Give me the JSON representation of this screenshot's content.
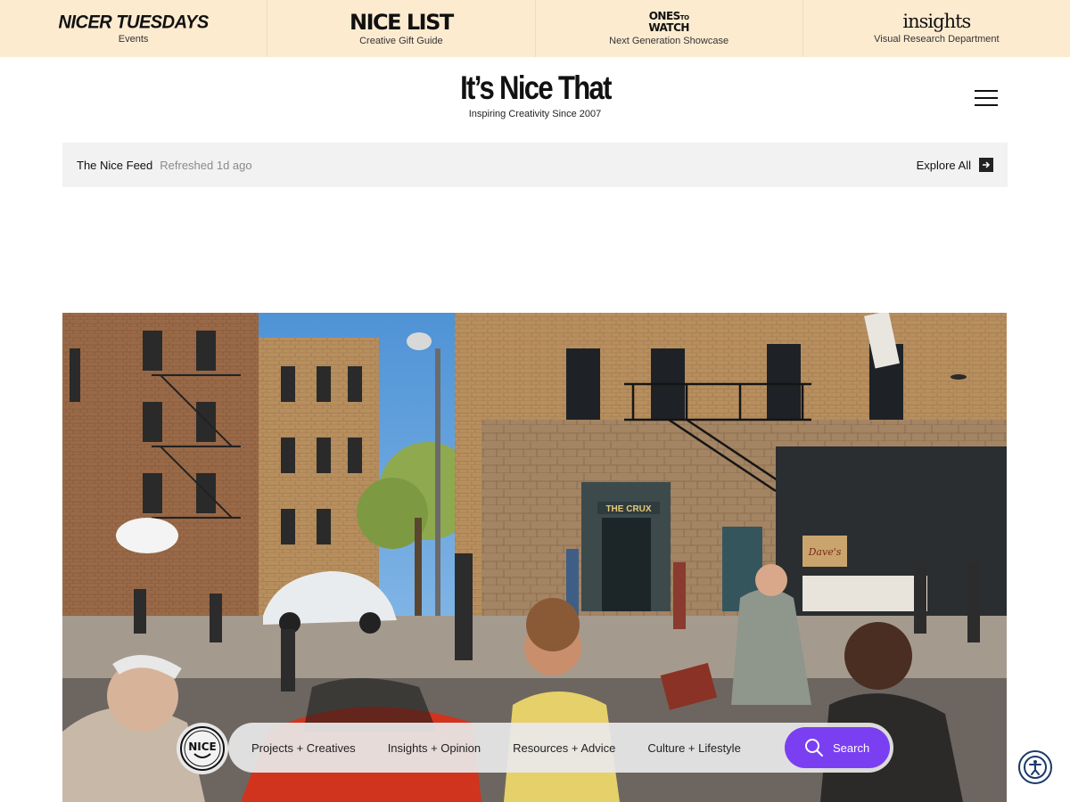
{
  "promo": [
    {
      "logo": "NICER TUESDAYS",
      "sub": "Events"
    },
    {
      "logo": "NICE LIST",
      "sub": "Creative Gift Guide"
    },
    {
      "logo_top": "ONES",
      "logo_mid": "TO",
      "logo_bottom": "WATCH",
      "sub": "Next Generation Showcase"
    },
    {
      "logo": "insights",
      "sub": "Visual Research Department"
    }
  ],
  "header": {
    "title": "It’s Nice That",
    "tagline": "Inspiring Creativity Since 2007",
    "menu_icon": "hamburger-menu-icon"
  },
  "feed": {
    "title": "The Nice Feed",
    "refreshed": "Refreshed 1d ago",
    "explore": "Explore All",
    "explore_icon": "arrow-right-icon"
  },
  "hero": {
    "sign_crux": "THE CRUX",
    "sign_shop": "Dave's"
  },
  "nav": {
    "badge": "NICE",
    "links": [
      "Projects + Creatives",
      "Insights + Opinion",
      "Resources + Advice",
      "Culture + Lifestyle"
    ],
    "search_label": "Search",
    "search_icon": "search-icon",
    "accent": "#7b3ff2"
  },
  "accessibility_icon": "accessibility-icon"
}
